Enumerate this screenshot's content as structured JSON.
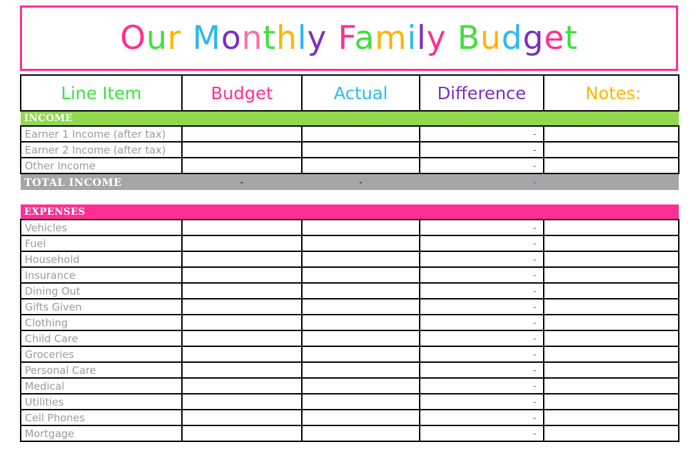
{
  "title": {
    "full_text": "Our Monthly Family Budget",
    "letters": [
      {
        "ch": "O",
        "color": "#FF2E92"
      },
      {
        "ch": "u",
        "color": "#3FE03F"
      },
      {
        "ch": "r",
        "color": "#FFB400"
      },
      {
        "ch": " ",
        "color": "#000000"
      },
      {
        "ch": "M",
        "color": "#2BB8F0"
      },
      {
        "ch": "o",
        "color": "#7B2FBE"
      },
      {
        "ch": "n",
        "color": "#FF6FA8"
      },
      {
        "ch": "t",
        "color": "#3FE03F"
      },
      {
        "ch": "h",
        "color": "#FFB400"
      },
      {
        "ch": "l",
        "color": "#2BB8F0"
      },
      {
        "ch": "y",
        "color": "#7B2FBE"
      },
      {
        "ch": " ",
        "color": "#000000"
      },
      {
        "ch": "F",
        "color": "#FF2E92"
      },
      {
        "ch": "a",
        "color": "#3FE03F"
      },
      {
        "ch": "m",
        "color": "#FFB400"
      },
      {
        "ch": "i",
        "color": "#2BB8F0"
      },
      {
        "ch": "l",
        "color": "#7B2FBE"
      },
      {
        "ch": "y",
        "color": "#FF2E92"
      },
      {
        "ch": " ",
        "color": "#000000"
      },
      {
        "ch": "B",
        "color": "#3FE03F"
      },
      {
        "ch": "u",
        "color": "#FFB400"
      },
      {
        "ch": "d",
        "color": "#2BB8F0"
      },
      {
        "ch": "g",
        "color": "#7B2FBE"
      },
      {
        "ch": "e",
        "color": "#FF2E92"
      },
      {
        "ch": "t",
        "color": "#3FE03F"
      }
    ],
    "border_color": "#FF2E92"
  },
  "columns": {
    "line_item": "Line Item",
    "budget": "Budget",
    "actual": "Actual",
    "difference": "Difference",
    "notes": "Notes:"
  },
  "column_colors": {
    "line_item": "#3FE03F",
    "budget": "#FF2E92",
    "actual": "#2BB8F0",
    "difference": "#7B2FBE",
    "notes": "#FFB400"
  },
  "income": {
    "section_label": "INCOME",
    "section_color": "#92D84D",
    "rows": [
      {
        "label": "Earner 1 Income (after tax)",
        "budget": "",
        "actual": "",
        "difference": "-",
        "notes": ""
      },
      {
        "label": "Earner 2 Income (after tax)",
        "budget": "",
        "actual": "",
        "difference": "-",
        "notes": ""
      },
      {
        "label": "Other Income",
        "budget": "",
        "actual": "",
        "difference": "-",
        "notes": ""
      }
    ],
    "total": {
      "label": "TOTAL  INCOME",
      "budget": "-",
      "actual": "-",
      "difference": "-",
      "background": "#A6A6A6"
    }
  },
  "expenses": {
    "section_label": "EXPENSES",
    "section_color": "#FF2E92",
    "rows": [
      {
        "label": "Vehicles",
        "budget": "",
        "actual": "",
        "difference": "-",
        "notes": ""
      },
      {
        "label": "Fuel",
        "budget": "",
        "actual": "",
        "difference": "-",
        "notes": ""
      },
      {
        "label": "Household",
        "budget": "",
        "actual": "",
        "difference": "-",
        "notes": ""
      },
      {
        "label": "Insurance",
        "budget": "",
        "actual": "",
        "difference": "-",
        "notes": ""
      },
      {
        "label": "Dining Out",
        "budget": "",
        "actual": "",
        "difference": "-",
        "notes": ""
      },
      {
        "label": "Gifts Given",
        "budget": "",
        "actual": "",
        "difference": "-",
        "notes": ""
      },
      {
        "label": "Clothing",
        "budget": "",
        "actual": "",
        "difference": "-",
        "notes": ""
      },
      {
        "label": "Child Care",
        "budget": "",
        "actual": "",
        "difference": "-",
        "notes": ""
      },
      {
        "label": "Groceries",
        "budget": "",
        "actual": "",
        "difference": "-",
        "notes": ""
      },
      {
        "label": "Personal Care",
        "budget": "",
        "actual": "",
        "difference": "-",
        "notes": ""
      },
      {
        "label": "Medical",
        "budget": "",
        "actual": "",
        "difference": "-",
        "notes": ""
      },
      {
        "label": "Utilities",
        "budget": "",
        "actual": "",
        "difference": "-",
        "notes": ""
      },
      {
        "label": "Cell Phones",
        "budget": "",
        "actual": "",
        "difference": "-",
        "notes": ""
      },
      {
        "label": "Mortgage",
        "budget": "",
        "actual": "",
        "difference": "-",
        "notes": ""
      }
    ]
  }
}
